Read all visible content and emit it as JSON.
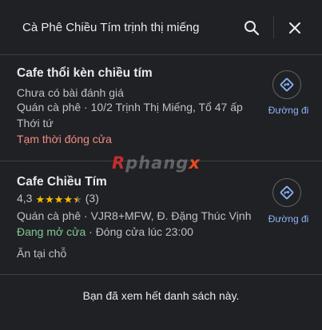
{
  "search": {
    "value": "Cà Phê Chiều Tím trịnh thị miếng",
    "search_icon": "search-icon",
    "close_icon": "close-icon"
  },
  "results": [
    {
      "title": "Cafe thổi kèn chiều tím",
      "rating_text": "Chưa có bài đánh giá",
      "address_line1": "Quán cà phê · 10/2 Trịnh Thị Miếng, Tổ 47 ấp",
      "address_line2": "Thới tứ",
      "status": "Tạm thời đóng cửa",
      "directions_label": "Đường đi"
    },
    {
      "title": "Cafe Chiều Tím",
      "rating": "4,3",
      "rating_stars": 4.3,
      "review_count": "(3)",
      "address_line1": "Quán cà phê · VJR8+MFW, Đ. Đặng Thúc Vịnh",
      "status_open": "Đang mở cửa",
      "hours": " · Đóng cửa lúc 23:00",
      "service": "Ăn tại chỗ",
      "directions_label": "Đường đi"
    }
  ],
  "watermark": {
    "r": "R",
    "mid": "phang",
    "x": "x"
  },
  "footer": "Bạn đã xem hết danh sách này.",
  "colors": {
    "background": "#202124",
    "accent_blue": "#8ab4f8",
    "closed_red": "#f28b82",
    "open_green": "#81c995",
    "star_yellow": "#fbbc04"
  }
}
